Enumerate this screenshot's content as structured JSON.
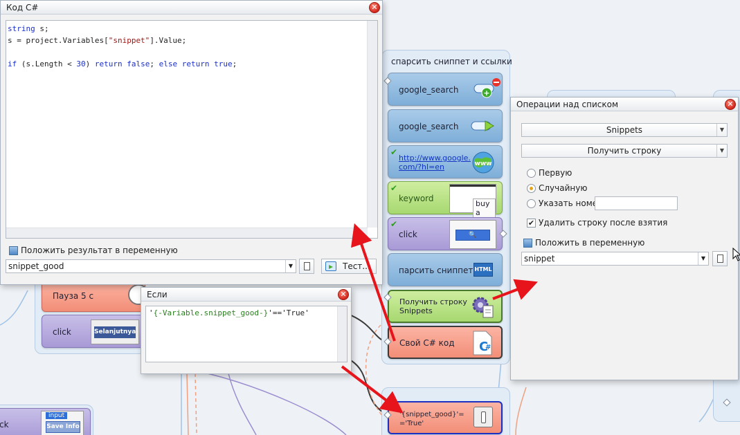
{
  "code_window": {
    "title": "Код C#",
    "code_lines": [
      [
        {
          "t": "string",
          "c": "kw"
        },
        {
          "t": " s;",
          "c": ""
        }
      ],
      [
        {
          "t": "s = project.Variables[",
          "c": ""
        },
        {
          "t": "\"snippet\"",
          "c": "str"
        },
        {
          "t": "].Value;",
          "c": ""
        }
      ],
      [
        {
          "t": "",
          "c": ""
        }
      ],
      [
        {
          "t": "if",
          "c": "kw"
        },
        {
          "t": " (s.Length < ",
          "c": ""
        },
        {
          "t": "30",
          "c": "num"
        },
        {
          "t": ") ",
          "c": ""
        },
        {
          "t": "return",
          "c": "kw"
        },
        {
          "t": " ",
          "c": ""
        },
        {
          "t": "false",
          "c": "kw"
        },
        {
          "t": "; ",
          "c": ""
        },
        {
          "t": "else",
          "c": "kw"
        },
        {
          "t": " ",
          "c": ""
        },
        {
          "t": "return",
          "c": "kw"
        },
        {
          "t": " ",
          "c": ""
        },
        {
          "t": "true",
          "c": "kw"
        },
        {
          "t": ";",
          "c": ""
        }
      ]
    ],
    "put_result_label": "Положить результат в переменную",
    "variable_value": "snippet_good",
    "test_button": "Тест..."
  },
  "if_window": {
    "title": "Если",
    "expr_prefix": "'",
    "expr_var": "{-Variable.snippet_good-}",
    "expr_suffix": "'=='True'"
  },
  "list_window": {
    "title": "Операции над списком",
    "list_select": "Snippets",
    "operation_select": "Получить строку",
    "radio_first": "Первую",
    "radio_random": "Случайную",
    "radio_number": "Указать номер",
    "radio_selected": "random",
    "delete_after_label": "Удалить строку после взятия",
    "delete_after_checked": true,
    "put_in_var_label": "Положить в переменную",
    "variable_value": "snippet"
  },
  "canvas": {
    "group_title": "спарсить сниппет и ссылки",
    "nodes": {
      "google_search_1": "google_search",
      "google_search_2": "google_search",
      "url": "http://www.google.com/?hl=en",
      "keyword": "keyword",
      "keyword_preview": "buy a",
      "click": "click",
      "parse_snippets": "парсить сниппеты",
      "get_line": "Получить строку Snippets",
      "custom_code": "Свой C# код",
      "condition": "'{snippet_good}'=='True'",
      "pause": "Пауза 5 с",
      "click_left": "click",
      "selanjutnya": "Selanjutnya",
      "click_bottom": "ck",
      "input_tag": "input",
      "save_info": "Save Info",
      "html_badge": "HTML"
    }
  },
  "colors": {
    "arrow": "#e8141b",
    "node_blue": "#8db8df",
    "node_red": "#f59f8b",
    "node_green": "#b7e085"
  }
}
